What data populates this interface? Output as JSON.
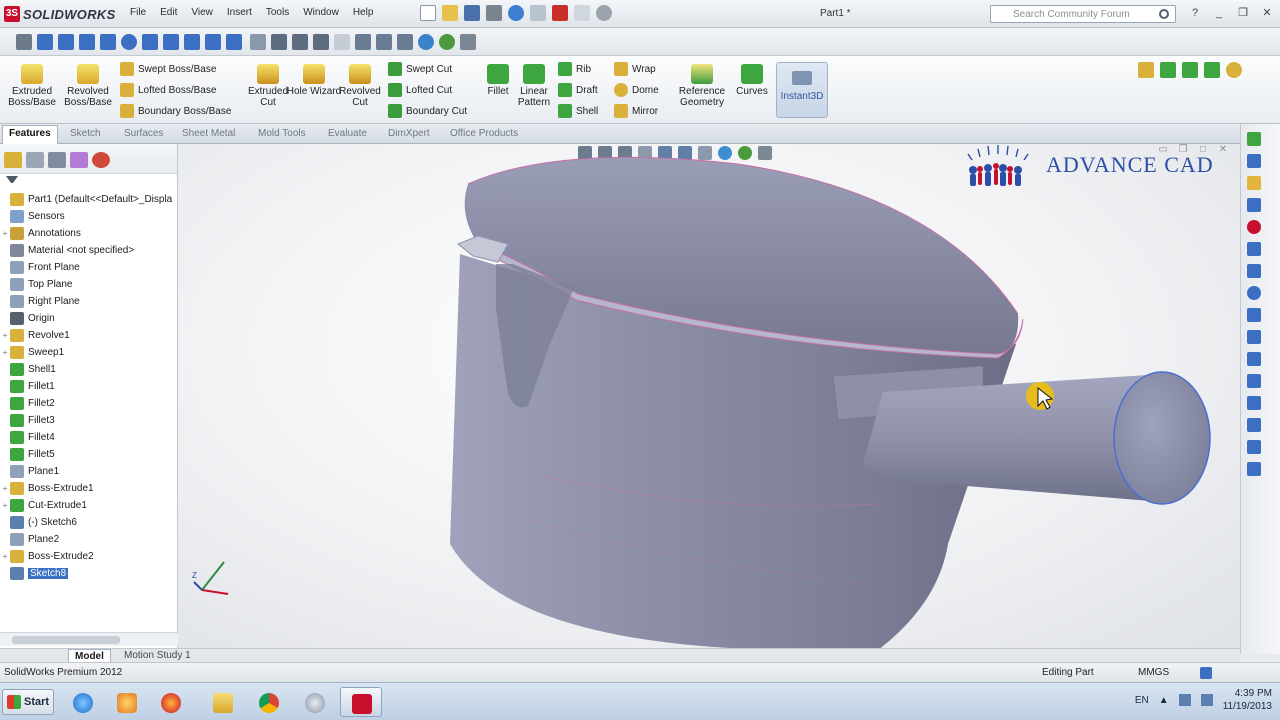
{
  "app": {
    "name": "SOLIDWORKS",
    "document_title": "Part1 *"
  },
  "menus": [
    "File",
    "Edit",
    "View",
    "Insert",
    "Tools",
    "Window",
    "Help"
  ],
  "search": {
    "placeholder": "Search Community Forum"
  },
  "command_manager": {
    "extruded_boss": "Extruded Boss/Base",
    "revolved_boss": "Revolved Boss/Base",
    "swept_boss": "Swept Boss/Base",
    "lofted_boss": "Lofted Boss/Base",
    "boundary_boss": "Boundary Boss/Base",
    "extruded_cut": "Extruded Cut",
    "hole_wizard": "Hole Wizard",
    "revolved_cut": "Revolved Cut",
    "swept_cut": "Swept Cut",
    "lofted_cut": "Lofted Cut",
    "boundary_cut": "Boundary Cut",
    "fillet": "Fillet",
    "linear_pattern": "Linear Pattern",
    "rib": "Rib",
    "draft": "Draft",
    "shell": "Shell",
    "wrap": "Wrap",
    "dome": "Dome",
    "mirror": "Mirror",
    "reference_geometry": "Reference Geometry",
    "curves": "Curves",
    "instant3d": "Instant3D"
  },
  "tabs": [
    "Features",
    "Sketch",
    "Surfaces",
    "Sheet Metal",
    "Mold Tools",
    "Evaluate",
    "DimXpert",
    "Office Products"
  ],
  "tree": {
    "root": "Part1  (Default<<Default>_Displa",
    "items": [
      {
        "label": "Sensors",
        "icon": "sensors-icon",
        "expander": ""
      },
      {
        "label": "Annotations",
        "icon": "annotations-icon",
        "expander": "+"
      },
      {
        "label": "Material <not specified>",
        "icon": "material-icon",
        "expander": ""
      },
      {
        "label": "Front Plane",
        "icon": "plane-icon",
        "expander": ""
      },
      {
        "label": "Top Plane",
        "icon": "plane-icon",
        "expander": ""
      },
      {
        "label": "Right Plane",
        "icon": "plane-icon",
        "expander": ""
      },
      {
        "label": "Origin",
        "icon": "origin-icon",
        "expander": ""
      },
      {
        "label": "Revolve1",
        "icon": "revolve-icon",
        "expander": "+"
      },
      {
        "label": "Sweep1",
        "icon": "sweep-icon",
        "expander": "+"
      },
      {
        "label": "Shell1",
        "icon": "shell-icon",
        "expander": ""
      },
      {
        "label": "Fillet1",
        "icon": "fillet-icon",
        "expander": ""
      },
      {
        "label": "Fillet2",
        "icon": "fillet-icon",
        "expander": ""
      },
      {
        "label": "Fillet3",
        "icon": "fillet-icon",
        "expander": ""
      },
      {
        "label": "Fillet4",
        "icon": "fillet-icon",
        "expander": ""
      },
      {
        "label": "Fillet5",
        "icon": "fillet-icon",
        "expander": ""
      },
      {
        "label": "Plane1",
        "icon": "plane-icon",
        "expander": ""
      },
      {
        "label": "Boss-Extrude1",
        "icon": "extrude-icon",
        "expander": "+"
      },
      {
        "label": "Cut-Extrude1",
        "icon": "cut-icon",
        "expander": "+"
      },
      {
        "label": "(-) Sketch6",
        "icon": "sketch-icon",
        "expander": ""
      },
      {
        "label": "Plane2",
        "icon": "plane-icon",
        "expander": ""
      },
      {
        "label": "Boss-Extrude2",
        "icon": "extrude-icon",
        "expander": "+"
      },
      {
        "label": "Sketch8",
        "icon": "sketch-icon",
        "expander": "",
        "selected": true
      }
    ]
  },
  "viewport": {
    "brand": "ADVANCE CAD"
  },
  "model_tabs": [
    "Model",
    "Motion Study 1"
  ],
  "status": {
    "product": "SolidWorks Premium 2012",
    "mode": "Editing Part",
    "units": "MMGS"
  },
  "taskbar": {
    "start": "Start",
    "lang": "EN",
    "time": "4:39 PM",
    "date": "11/19/2013"
  },
  "colors": {
    "accent": "#3a6fc4",
    "part": "#8d92a8",
    "brand": "#2b4fa8"
  }
}
